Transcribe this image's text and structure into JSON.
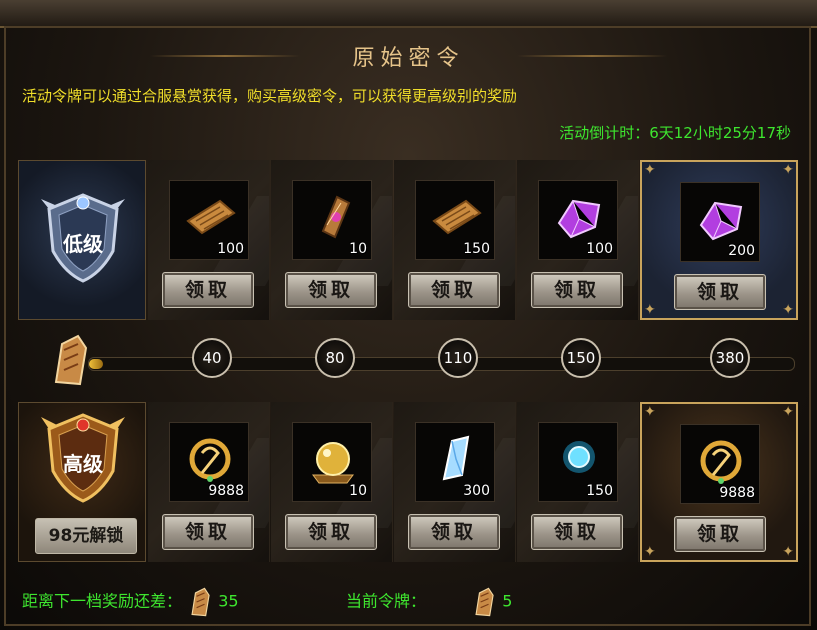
{
  "title": "原始密令",
  "subtitle": "活动令牌可以通过合服悬赏获得，购买高级密令，可以获得更高级别的奖励",
  "countdown": "活动倒计时：6天12小时25分17秒",
  "low_tier": {
    "label": "低级",
    "rewards": [
      {
        "icon": "scroll-icon",
        "qty": "100",
        "claim": "领取"
      },
      {
        "icon": "talisman-icon",
        "qty": "10",
        "claim": "领取"
      },
      {
        "icon": "scroll-icon",
        "qty": "150",
        "claim": "领取"
      },
      {
        "icon": "purple-gem-icon",
        "qty": "100",
        "claim": "领取"
      },
      {
        "icon": "purple-gem-icon",
        "qty": "200",
        "claim": "领取"
      }
    ]
  },
  "milestones": [
    "40",
    "80",
    "110",
    "150",
    "380"
  ],
  "progress_fraction": 0.02,
  "high_tier": {
    "label": "高级",
    "unlock": "98元解锁",
    "rewards": [
      {
        "icon": "gold-token-icon",
        "qty": "9888",
        "claim": "领取"
      },
      {
        "icon": "gold-orb-icon",
        "qty": "10",
        "claim": "领取"
      },
      {
        "icon": "ice-crystal-icon",
        "qty": "300",
        "claim": "领取"
      },
      {
        "icon": "blue-orb-icon",
        "qty": "150",
        "claim": "领取"
      },
      {
        "icon": "gold-token-icon",
        "qty": "9888",
        "claim": "领取"
      }
    ]
  },
  "footer": {
    "next_label": "距离下一档奖励还差：",
    "next_value": "35",
    "current_label": "当前令牌：",
    "current_value": "5"
  },
  "colors": {
    "green": "#3ee62f",
    "yellow": "#f0de2a",
    "gold": "#c9a45c"
  }
}
